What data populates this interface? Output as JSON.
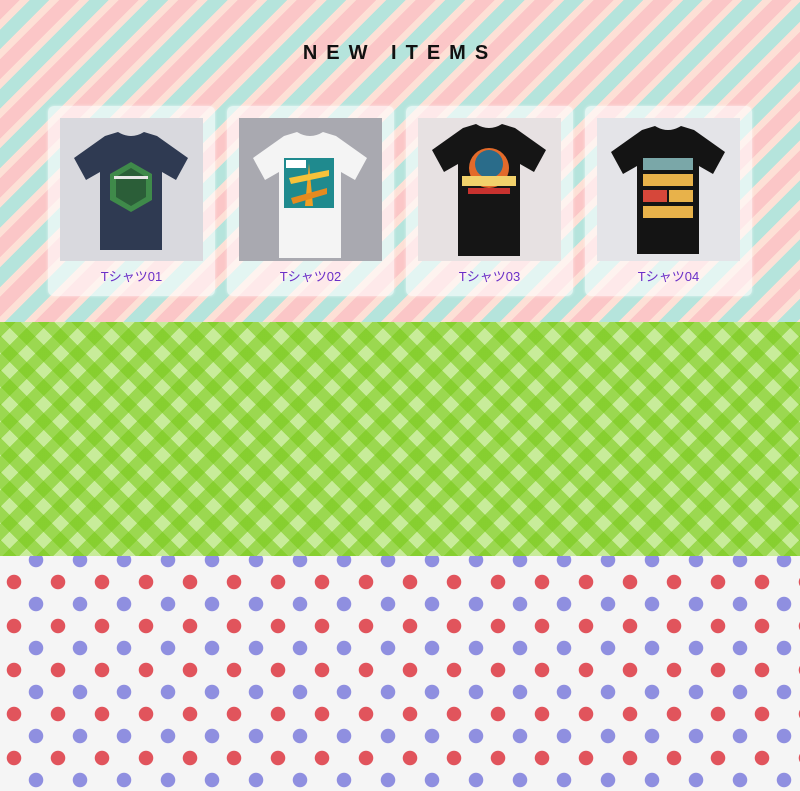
{
  "section": {
    "heading": "NEW ITEMS"
  },
  "products": [
    {
      "name": "Tシャツ01",
      "shirt_color": "#2f3a52",
      "photo_bg": "#d9d9de"
    },
    {
      "name": "Tシャツ02",
      "shirt_color": "#f4f4f4",
      "photo_bg": "#a9a9b0"
    },
    {
      "name": "Tシャツ03",
      "shirt_color": "#151515",
      "photo_bg": "#e7e1e2"
    },
    {
      "name": "Tシャツ04",
      "shirt_color": "#141414",
      "photo_bg": "#e4e4e8"
    }
  ],
  "colors": {
    "stripe_pink": "#fbc6c7",
    "stripe_mint": "#b5e4dc",
    "gingham_green": "#76c814",
    "dot_red": "#e1545c",
    "dot_blue": "#8f8fe0",
    "caption_purple": "#6b30c8"
  }
}
